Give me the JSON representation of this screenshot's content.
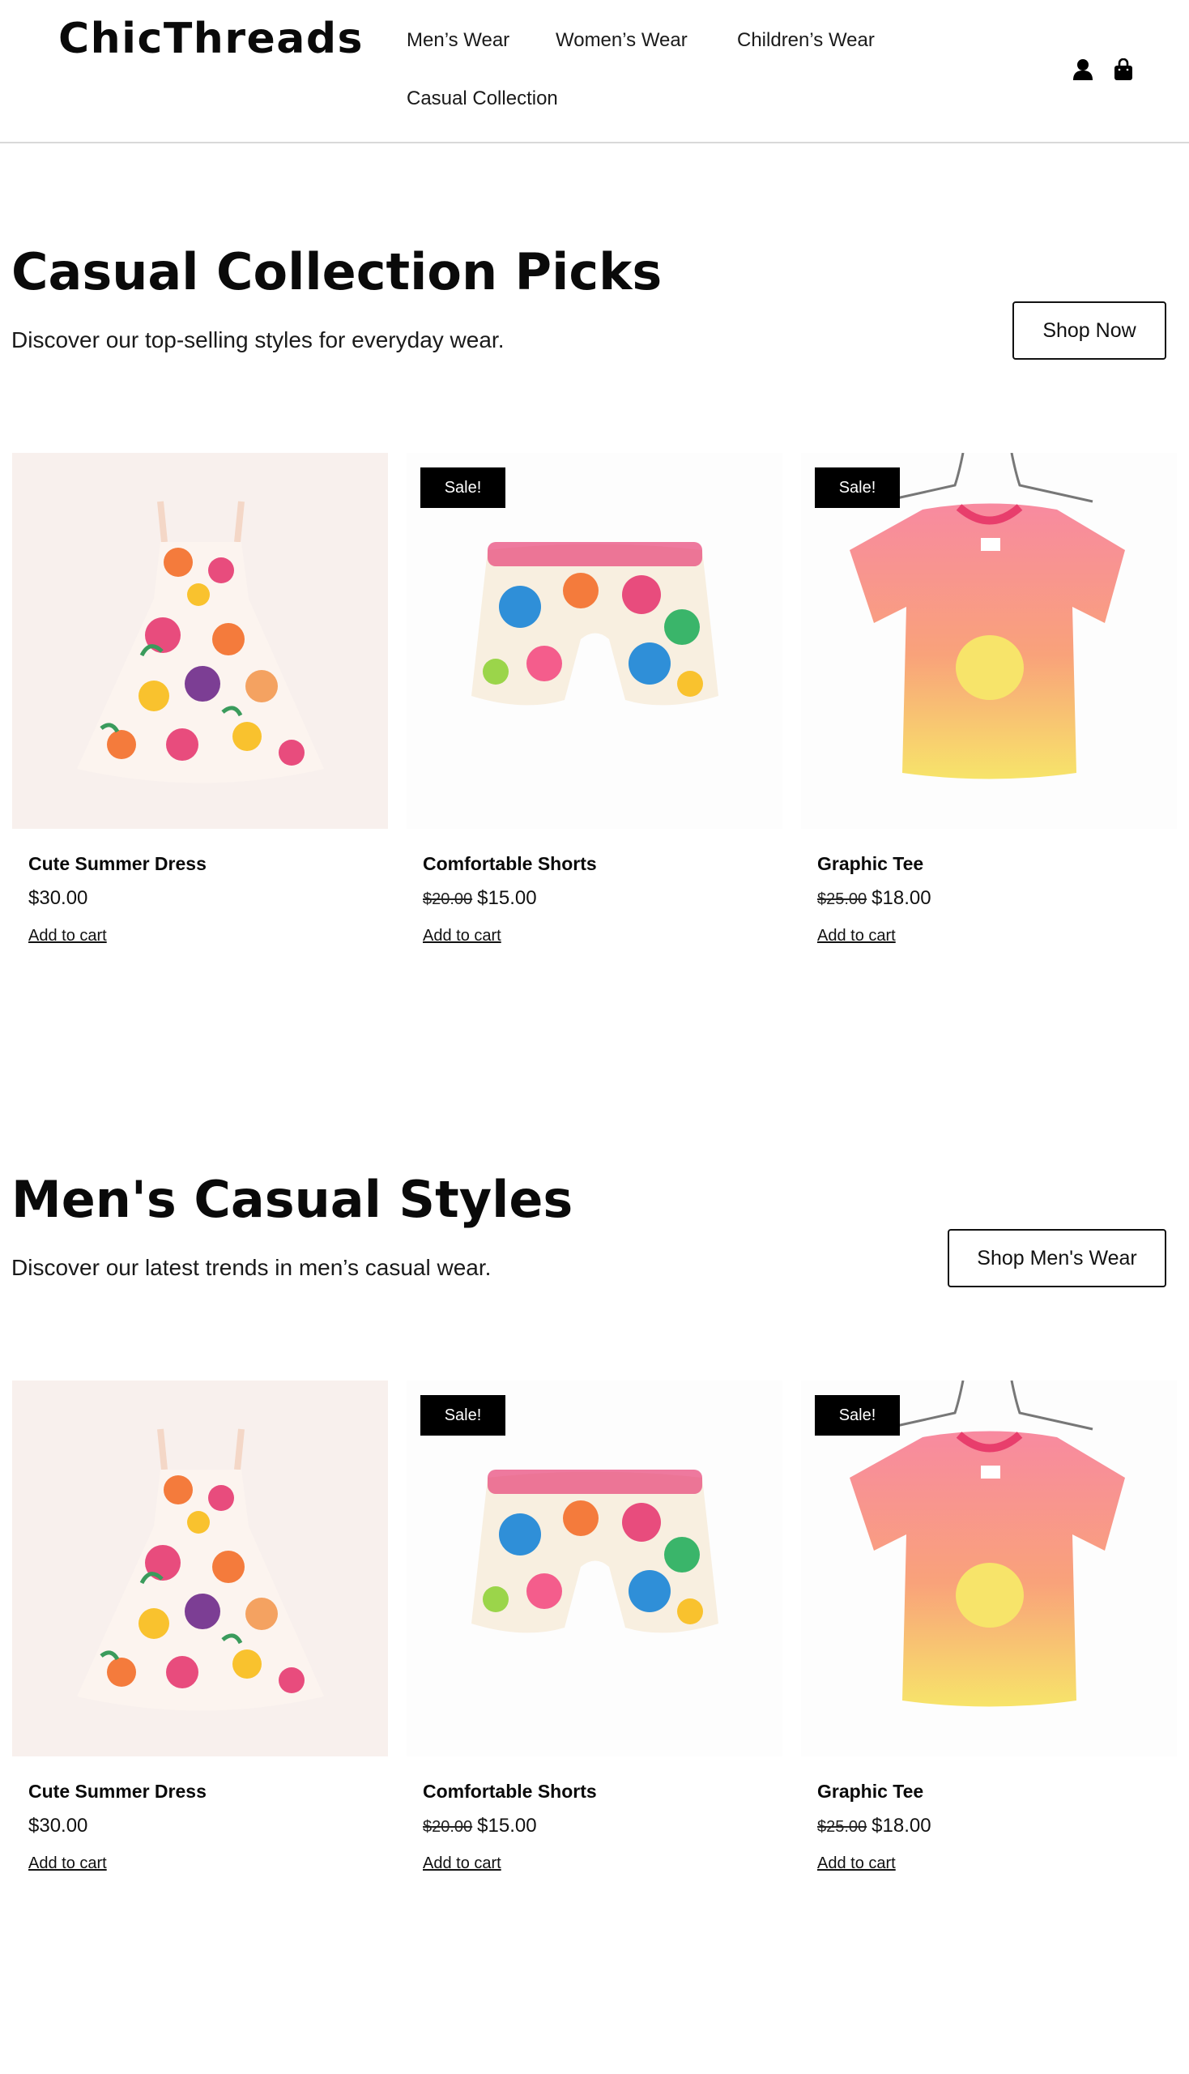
{
  "brand": {
    "logo_text": "ChicThreads"
  },
  "nav": {
    "items": [
      {
        "label": "Men’s Wear"
      },
      {
        "label": "Women’s Wear"
      },
      {
        "label": "Children’s Wear"
      },
      {
        "label": "Casual Collection"
      }
    ]
  },
  "header_icons": [
    "user-icon",
    "shopping-bag-icon"
  ],
  "colors": {
    "text": "#111111",
    "badge_background": "#000000",
    "badge_text": "#ffffff",
    "border": "#d9d9d9"
  },
  "sections": [
    {
      "title": "Casual Collection Picks",
      "subtitle": "Discover our top-selling styles for everyday wear.",
      "button_label": "Shop Now",
      "products": [
        {
          "name": "Cute Summer Dress",
          "price": "$30.00",
          "old_price": "",
          "sale_badge": "",
          "add_to_cart": "Add to cart",
          "image": "floral-dress"
        },
        {
          "name": "Comfortable Shorts",
          "price": "$15.00",
          "old_price": "$20.00",
          "sale_badge": "Sale!",
          "add_to_cart": "Add to cart",
          "image": "floral-shorts"
        },
        {
          "name": "Graphic Tee",
          "price": "$18.00",
          "old_price": "$25.00",
          "sale_badge": "Sale!",
          "add_to_cart": "Add to cart",
          "image": "gradient-tee"
        }
      ]
    },
    {
      "title": "Men's Casual Styles",
      "subtitle": "Discover our latest trends in men’s casual wear.",
      "button_label": "Shop Men's Wear",
      "products": [
        {
          "name": "Cute Summer Dress",
          "price": "$30.00",
          "old_price": "",
          "sale_badge": "",
          "add_to_cart": "Add to cart",
          "image": "floral-dress"
        },
        {
          "name": "Comfortable Shorts",
          "price": "$15.00",
          "old_price": "$20.00",
          "sale_badge": "Sale!",
          "add_to_cart": "Add to cart",
          "image": "floral-shorts"
        },
        {
          "name": "Graphic Tee",
          "price": "$18.00",
          "old_price": "$25.00",
          "sale_badge": "Sale!",
          "add_to_cart": "Add to cart",
          "image": "gradient-tee"
        }
      ]
    }
  ]
}
